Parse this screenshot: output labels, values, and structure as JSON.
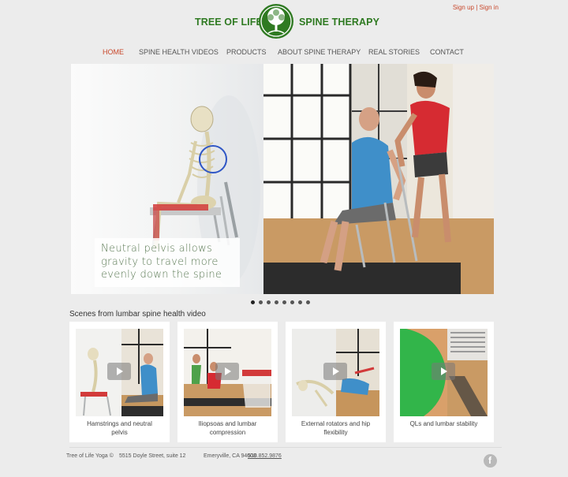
{
  "header": {
    "auth": {
      "sign_up": "Sign up",
      "separator": "|",
      "sign_in": "Sign in"
    },
    "logo": {
      "left_text": "TREE OF LIFE",
      "right_text": "SPINE THERAPY",
      "icon": "tree-icon"
    }
  },
  "nav": {
    "items": [
      {
        "label": "HOME",
        "active": true
      },
      {
        "label": "SPINE HEALTH VIDEOS",
        "active": false
      },
      {
        "label": "PRODUCTS",
        "active": false
      },
      {
        "label": "ABOUT SPINE THERAPY",
        "active": false
      },
      {
        "label": "REAL STORIES",
        "active": false
      },
      {
        "label": "CONTACT",
        "active": false
      }
    ]
  },
  "slider": {
    "caption_lines": [
      "Neutral pelvis allows",
      "gravity to travel more",
      "evenly down the spine"
    ],
    "slide_count": 8,
    "active_slide": 1
  },
  "scenes": {
    "title": "Scenes from lumbar spine health video",
    "cards": [
      {
        "caption_lines": [
          "Hamstrings and neutral",
          "pelvis"
        ]
      },
      {
        "caption_lines": [
          "Iliopsoas and lumbar",
          "compression"
        ]
      },
      {
        "caption_lines": [
          "External rotators and hip",
          "flexibility"
        ]
      },
      {
        "caption_lines": [
          "QLs and lumbar stability"
        ]
      }
    ]
  },
  "footer": {
    "company": "Tree of Life Yoga ©",
    "street": "5515 Doyle Street, suite 12",
    "city": "Emeryville, CA 94608",
    "phone": "510.852.9876",
    "social_icon": "facebook-icon"
  },
  "colors": {
    "accent": "#c8472b",
    "brand_green": "#2f7a22",
    "background": "#ececec",
    "caption_green": "#5b7a54"
  }
}
